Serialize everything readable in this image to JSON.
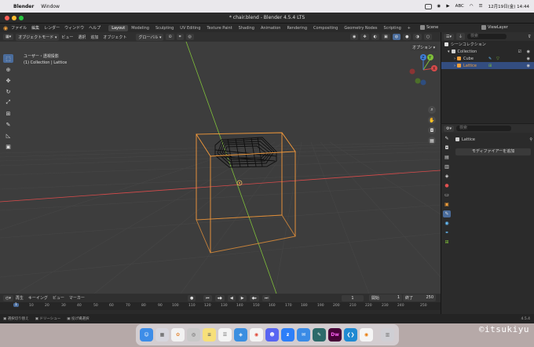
{
  "menubar": {
    "app": "Blender",
    "items": [
      "Window"
    ],
    "date_time": "12月19日(金)  14:44",
    "input_mode": "ABC"
  },
  "window": {
    "title": "* chair.blend - Blender 4.5.4 LTS"
  },
  "topbar": {
    "menus": [
      "ファイル",
      "編集",
      "レンダー",
      "ウィンドウ",
      "ヘルプ"
    ],
    "workspaces": [
      "Layout",
      "Modeling",
      "Sculpting",
      "UV Editing",
      "Texture Paint",
      "Shading",
      "Animation",
      "Rendering",
      "Compositing",
      "Geometry Nodes",
      "Scripting"
    ],
    "active_workspace": "Layout",
    "scene": "Scene",
    "view_layer": "ViewLayer"
  },
  "viewport_header": {
    "mode": "オブジェクトモード",
    "menus": [
      "ビュー",
      "選択",
      "追加",
      "オブジェクト"
    ],
    "transform_orientation": "グローバル",
    "options": "オプション"
  },
  "viewport": {
    "view_name": "ユーザー・透視投影",
    "collection_info": "(1) Collection | Lattice",
    "gizmo": {
      "x": "X",
      "y": "Y",
      "z": "Z"
    }
  },
  "outliner": {
    "title": "シーンコレクション",
    "search_placeholder": "検索",
    "rows": [
      {
        "label": "Collection",
        "selected": false
      },
      {
        "label": "Cube",
        "selected": false
      },
      {
        "label": "Lattice",
        "selected": true
      }
    ]
  },
  "properties": {
    "search_placeholder": "検索",
    "object_name": "Lattice",
    "add_modifier": "モディファイアーを追加"
  },
  "timeline": {
    "menus": [
      "再生",
      "キーイング",
      "ビュー",
      "マーカー"
    ],
    "current_frame": "1",
    "start_label": "開始",
    "start": "1",
    "end_label": "終了",
    "end": "250",
    "ticks": [
      "1",
      "10",
      "20",
      "30",
      "40",
      "50",
      "60",
      "70",
      "80",
      "90",
      "100",
      "110",
      "120",
      "130",
      "140",
      "150",
      "160",
      "170",
      "180",
      "190",
      "200",
      "210",
      "220",
      "230",
      "240",
      "250"
    ]
  },
  "statusbar": {
    "items": [
      "選択切り替え",
      "ドリーシュー",
      "投げ縄選択"
    ],
    "version": "4.5.4"
  },
  "dock": {
    "apps": [
      "Finder",
      "Launchpad",
      "Photos",
      "Chrome",
      "Notes",
      "Reminders",
      "Safari",
      "Chrome2",
      "Discord",
      "Zoom",
      "Mail",
      "Pencil",
      "Dreamweaver",
      "VS Code",
      "Blender",
      "Trash"
    ]
  },
  "watermark": "©itsukiyu",
  "colors": {
    "selection": "#334d80",
    "lattice": "#f59a3a",
    "active_tool": "#4a6c9c",
    "x_axis": "#d84b4b",
    "y_axis": "#7fbf3a",
    "z_axis": "#3f7dd8"
  }
}
